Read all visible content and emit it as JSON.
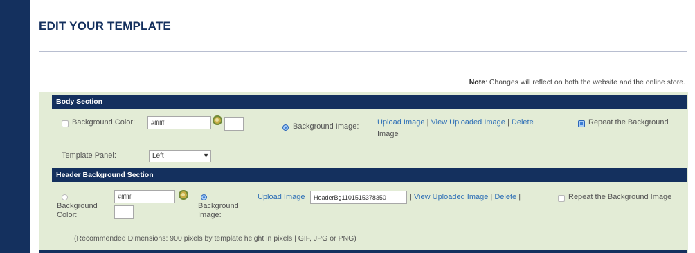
{
  "page": {
    "title": "EDIT YOUR TEMPLATE",
    "note_label": "Note",
    "note_text": ": Changes will reflect on both the website and the online store."
  },
  "body_section": {
    "header": "Body Section",
    "bg_color_label": "Background Color:",
    "bg_color_value": "#ffffff",
    "bg_image_label": "Background Image:",
    "upload_link": "Upload Image",
    "view_link": "View Uploaded Image",
    "delete_link_1": "Delete",
    "delete_link_2": "Image",
    "separator": "|",
    "repeat_label": "Repeat the Background",
    "template_panel_label": "Template Panel:",
    "template_panel_value": "Left"
  },
  "header_section": {
    "header": "Header Background Section",
    "bg_color_label_1": "Background",
    "bg_color_label_2": "Color:",
    "bg_color_value": "#ffffff",
    "bg_image_label_1": "Background",
    "bg_image_label_2": "Image:",
    "upload_link": "Upload Image",
    "upload_filename": "HeaderBg1101515378350",
    "view_link": "View Uploaded Image",
    "delete_link": "Delete",
    "separator": "|",
    "repeat_label": "Repeat the Background Image",
    "hint": "(Recommended Dimensions: 900 pixels by template height in pixels | GIF, JPG or PNG)"
  },
  "icons": {
    "color_picker": "palette-icon",
    "select_arrow": "chevron-down-icon"
  },
  "colors": {
    "navy": "#14305e",
    "panel_green": "#e3ecd6",
    "link_blue": "#2e6fb6"
  }
}
